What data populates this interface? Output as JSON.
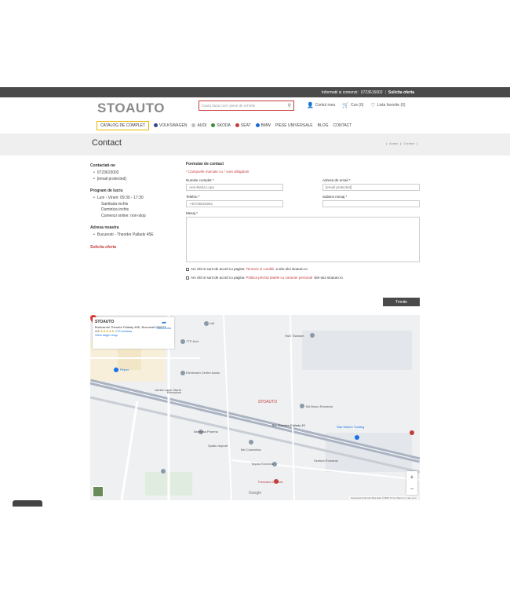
{
  "topbar": {
    "info": "Informatii si comenzi:",
    "phone": "0723615002",
    "offer": "Solicita oferta"
  },
  "header": {
    "logo": "STOAUTO",
    "search_placeholder": "Cauta dupa cod / piese de schimb",
    "account": "Contul meu",
    "cart": "Cos (0)",
    "wishlist": "Lista favorite (0)"
  },
  "nav": {
    "items": [
      "CATALOG DE COMPLET",
      "VOLKSWAGEN",
      "AUDI",
      "SKODA",
      "SEAT",
      "BMW",
      "PIESE UNIVERSALE",
      "BLOG",
      "CONTACT"
    ]
  },
  "page": {
    "title": "Contact",
    "breadcrumb": [
      "Acasa",
      "Contact"
    ]
  },
  "sidebar": {
    "contact_heading": "Contactati-ne",
    "contact_items": [
      "0723615002",
      "[email protected]"
    ],
    "program_heading": "Program de lucru",
    "program_first": "Luni - Vineri: 09:30 - 17:30",
    "program_rest": [
      "Sambata inchis",
      "Duminica inchis",
      "Comenzi online: non-stop"
    ],
    "address_heading": "Adresa noastra",
    "address_items": [
      "Bucuresti - Theodor Pallady 45E"
    ],
    "offer_link": "Solicita oferta"
  },
  "form": {
    "title": "Formular de contact",
    "required_note": "* Campurile marcate cu * sunt obligatorii",
    "name_label": "Numele complet *",
    "name_value": "Ana-Maria Lupu",
    "email_label": "Adresa de email *",
    "email_value": "[email protected]",
    "phone_label": "Telefon *",
    "phone_value": "+40735615061",
    "subject_label": "Subiect mesaj *",
    "subject_value": "",
    "message_label": "Mesaj *",
    "terms_prefix": "Am citit si sunt de acord cu pagina",
    "terms_link": "Termeni si conditii",
    "terms_suffix": "a site-ului stoauto.ro",
    "privacy_prefix": "Am citit si sunt de acord cu pagina",
    "privacy_link": "Politica privind datele cu caracter personal",
    "privacy_suffix": "site-ului stoauto.ro",
    "send_label": "Trimite"
  },
  "map": {
    "card_title": "STOAUTO",
    "card_address": "Bulevardul Theodor Pallady 45E, Bucuresti 032277",
    "card_rating": "4.5",
    "card_stars": "★★★★★",
    "card_reviews": "170 reviews",
    "card_larger": "View larger map",
    "directions": "Directions",
    "pin_label": "STOAUTO",
    "labels": [
      "Lidl",
      "TTP Kurt",
      "H&S Titanium",
      "Pepco",
      "Electrosim Centre Aauto",
      "Jamila Laser Marta",
      "Bd. Theodor Pallady 45",
      "BA Bravo Romania",
      "Baneasa Pharma",
      "Star Motors Trading",
      "Spatiu depozit",
      "Toyota Romania",
      "Sentina Romania",
      "Farmacia Dr. Max",
      "Bricostore",
      "Bel Cosmetics",
      "Google"
    ],
    "zoom_in": "+",
    "zoom_out": "−",
    "attribution": "Keyboard shortcuts   Map data ©2025   Terms   Report a map error"
  }
}
